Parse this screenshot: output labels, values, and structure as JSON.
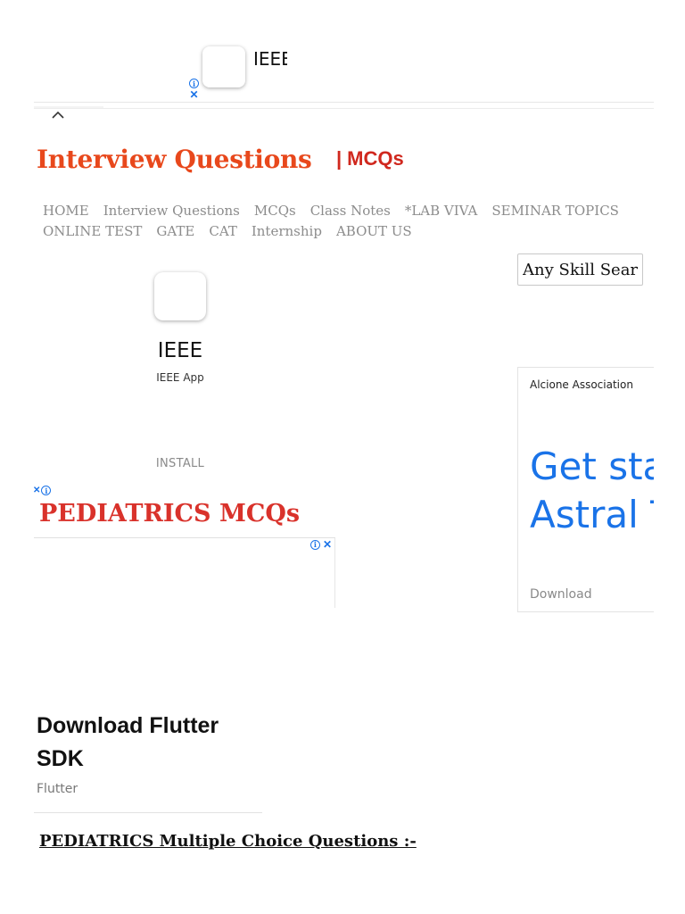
{
  "top_ad": {
    "app_name": "IEEE"
  },
  "site": {
    "logo_main": "Interview Questions",
    "logo_separator": "|",
    "logo_sub": "MCQs"
  },
  "nav": {
    "row1": [
      "HOME",
      "Interview Questions",
      "MCQs",
      "Class Notes",
      "*LAB VIVA",
      "SEMINAR TOPICS"
    ],
    "row2": [
      "ONLINE TEST",
      "GATE",
      "CAT",
      "Internship",
      "ABOUT US"
    ]
  },
  "search": {
    "placeholder": "Any Skill Search"
  },
  "side_ad": {
    "title": "IEEE",
    "subtitle": "IEEE App",
    "install_label": "INSTALL"
  },
  "right_ad": {
    "advertiser": "Alcione Association",
    "headline_line1": "Get started",
    "headline_line2": "Astral Today",
    "cta": "Download"
  },
  "post": {
    "title": "PEDIATRICS MCQs",
    "section_heading": "PEDIATRICS Multiple Choice Questions :-"
  },
  "flutter_ad": {
    "title_line1": "Download Flutter",
    "title_line2": "SDK",
    "advertiser": "Flutter"
  },
  "colors": {
    "logo": "#e8481c",
    "logo_sub": "#d0281e",
    "post_title": "#d9322b",
    "nav_text": "#8c8c8c",
    "ad_blue": "#1a73e8"
  }
}
